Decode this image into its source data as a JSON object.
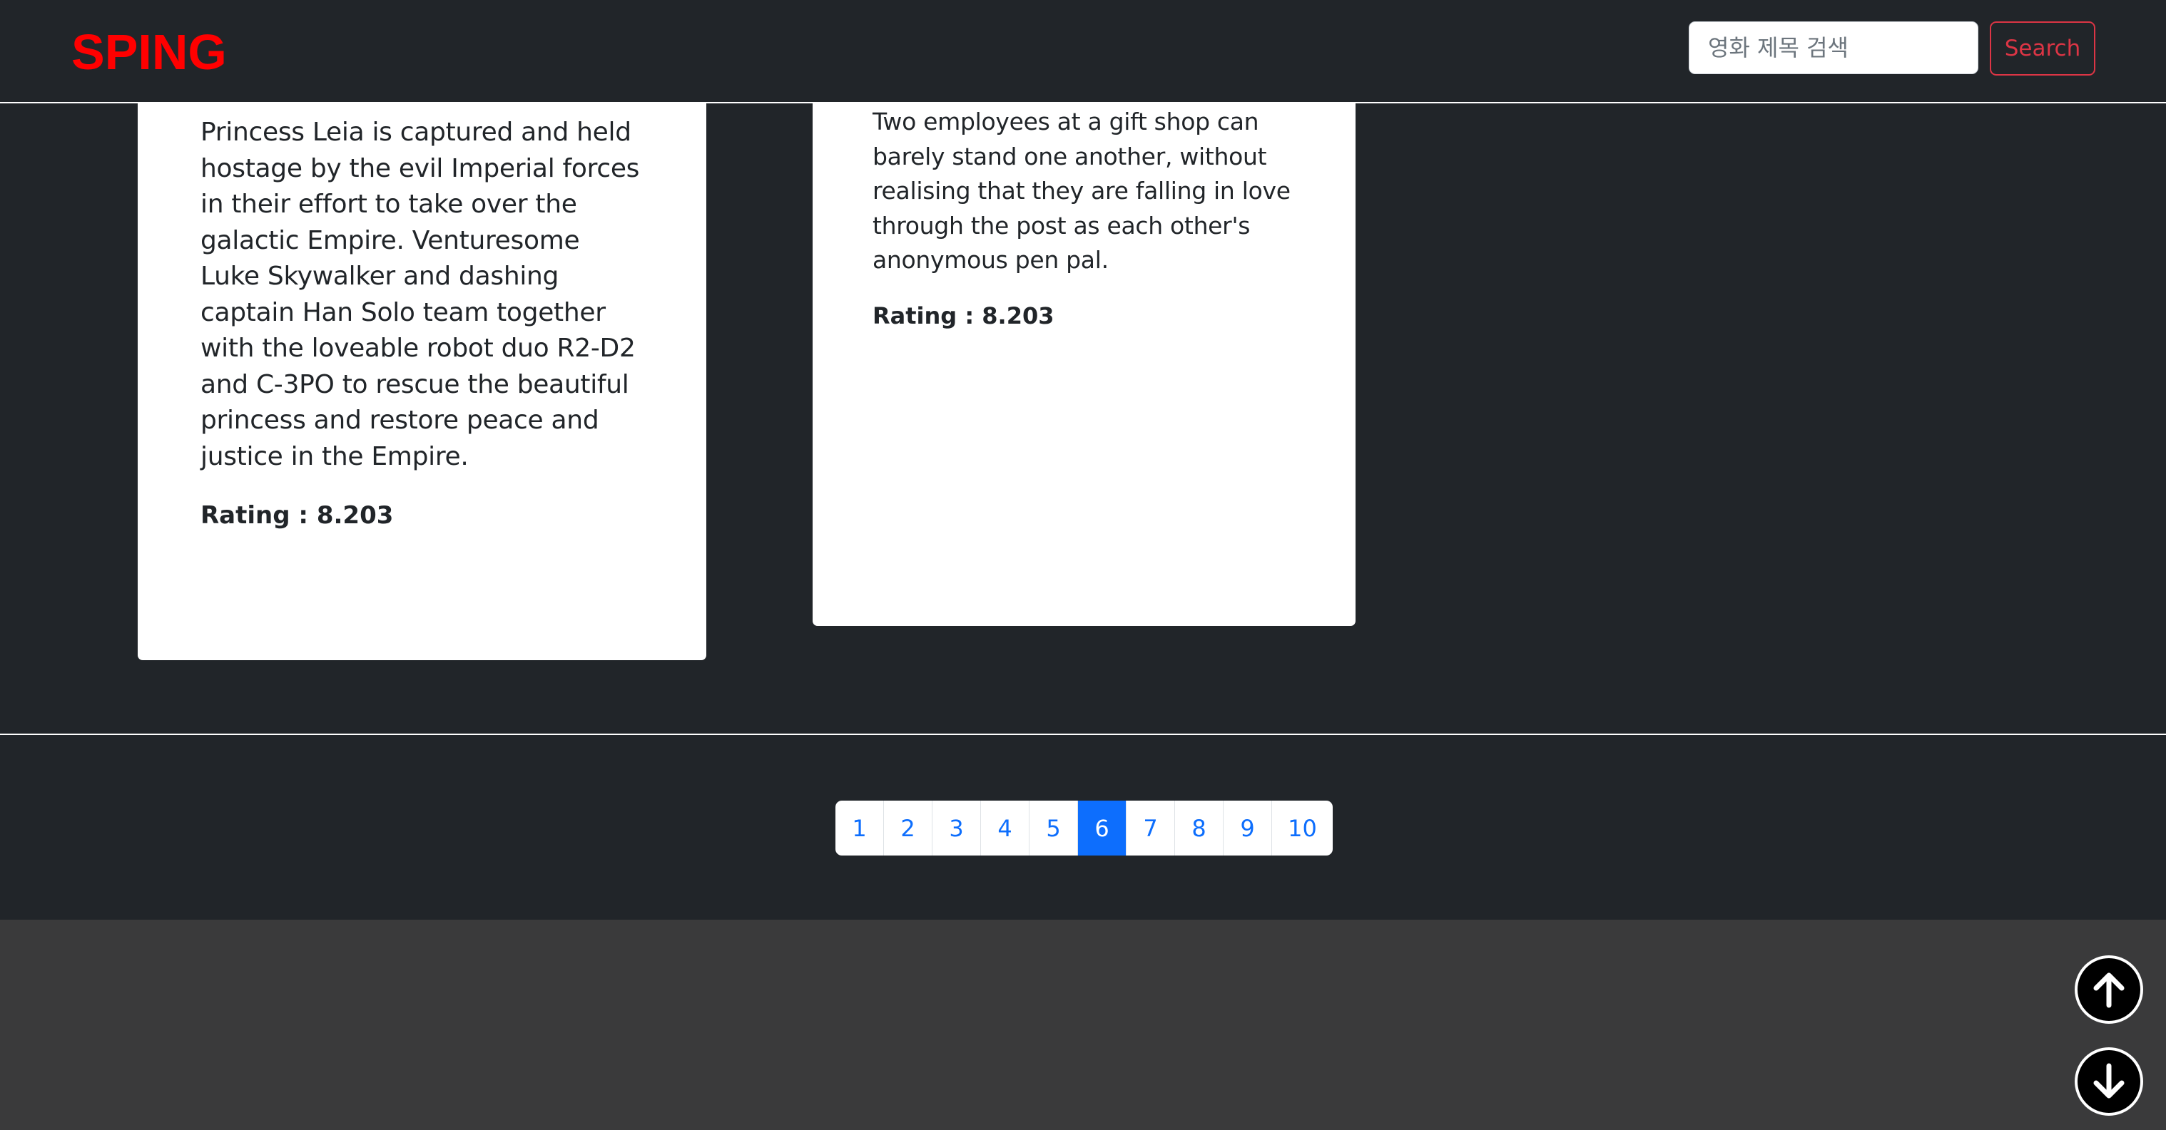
{
  "header": {
    "brand": "SPING",
    "search_placeholder": "영화 제목 검색",
    "search_button": "Search"
  },
  "movies": [
    {
      "overview": "Princess Leia is captured and held hostage by the evil Imperial forces in their effort to take over the galactic Empire. Venturesome Luke Skywalker and dashing captain Han Solo team together with the loveable robot duo R2-D2 and C-3PO to rescue the beautiful princess and restore peace and justice in the Empire.",
      "rating": "Rating : 8.203"
    },
    {
      "overview": "Two employees at a gift shop can barely stand one another, without realising that they are falling in love through the post as each other's anonymous pen pal.",
      "rating": "Rating : 8.203"
    }
  ],
  "pagination": {
    "pages": [
      "1",
      "2",
      "3",
      "4",
      "5",
      "6",
      "7",
      "8",
      "9",
      "10"
    ],
    "active": "6"
  },
  "icons": {
    "scroll_up": "arrow-up-circle-icon",
    "scroll_down": "arrow-down-circle-icon"
  },
  "colors": {
    "brand": "#ff0000",
    "accent": "#0d6efd",
    "danger": "#dc3545",
    "dark_bg": "#212529",
    "footer_bg": "#3a3a3b"
  }
}
